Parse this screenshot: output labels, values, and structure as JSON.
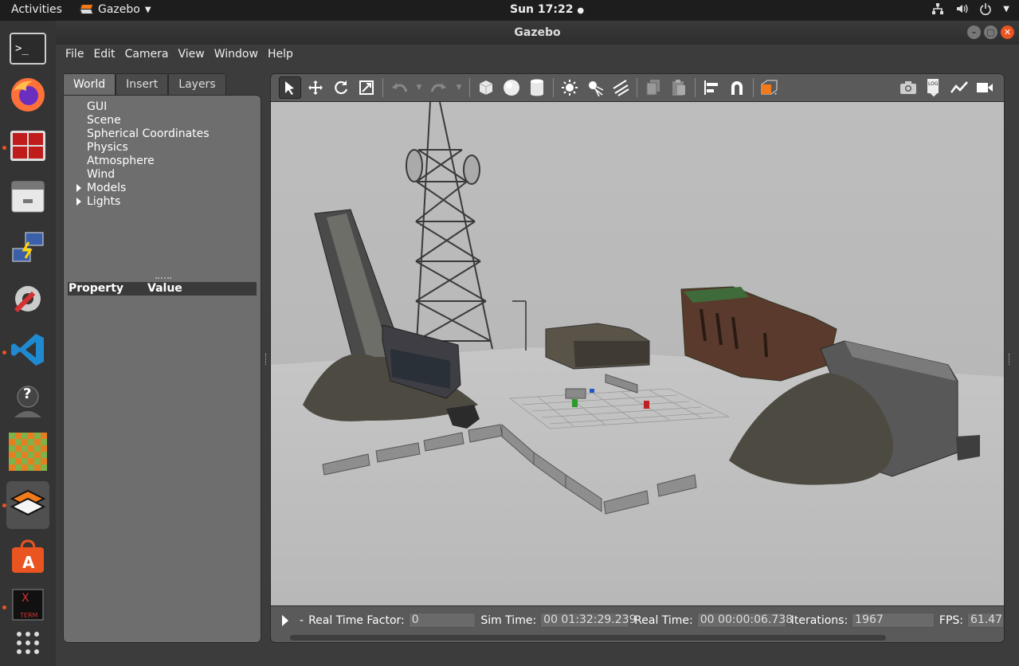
{
  "topbar": {
    "activities": "Activities",
    "app_name": "Gazebo",
    "clock": "Sun 17:22"
  },
  "window": {
    "title": "Gazebo"
  },
  "menu": [
    "File",
    "Edit",
    "Camera",
    "View",
    "Window",
    "Help"
  ],
  "left_tabs": [
    "World",
    "Insert",
    "Layers"
  ],
  "world_tree": [
    "GUI",
    "Scene",
    "Spherical Coordinates",
    "Physics",
    "Atmosphere",
    "Wind",
    "Models",
    "Lights"
  ],
  "properties": {
    "col_property": "Property",
    "col_value": "Value"
  },
  "status": {
    "rtf_label": "Real Time Factor:",
    "rtf_value": "0",
    "sim_time_label": "Sim Time:",
    "sim_time_value": "00 01:32:29.239",
    "real_time_label": "Real Time:",
    "real_time_value": "00 00:00:06.738",
    "iterations_label": "Iterations:",
    "iterations_value": "1967",
    "fps_label": "FPS:",
    "fps_value": "61.47",
    "dash": "-"
  },
  "dock": {
    "help_glyph": "?",
    "xterm_glyph": "X"
  },
  "colors": {
    "accent": "#e95420",
    "gazebo_orange": "#f07a1c",
    "viewport_bg": "#bcbcbc"
  }
}
